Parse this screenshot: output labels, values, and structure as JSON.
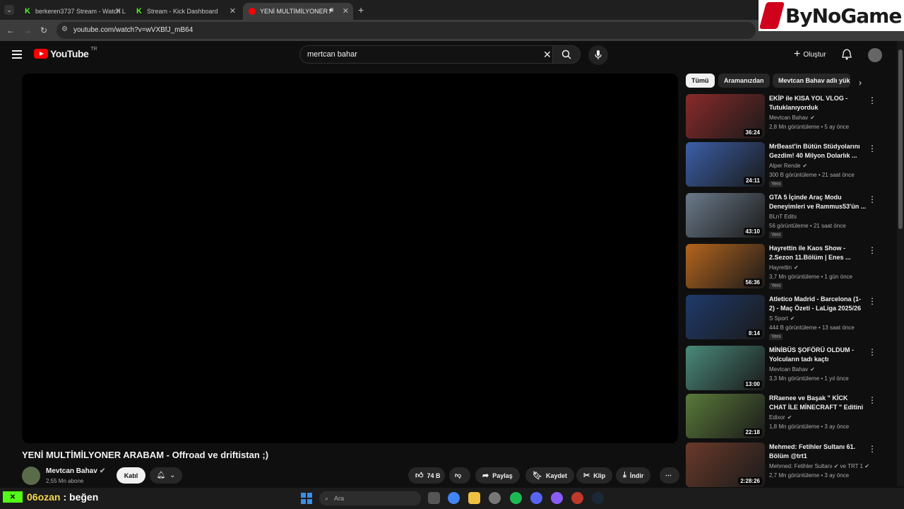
{
  "browser": {
    "tabs": [
      {
        "title": "berkeren3737 Stream - Watch L",
        "favicon": "kick-icon"
      },
      {
        "title": "Stream - Kick Dashboard",
        "favicon": "kick-icon"
      },
      {
        "title": "YENİ MULTİMİLYONER ARA",
        "favicon": "youtube-icon"
      }
    ],
    "url": "youtube.com/watch?v=wVXBfJ_mB64"
  },
  "watermark": {
    "text": "ByNoGame"
  },
  "youtube": {
    "logo_text": "YouTube",
    "region": "TR",
    "search_value": "mertcan bahar",
    "create_label": "Oluştur"
  },
  "video": {
    "title": "YENİ MULTİMİLYONER ARABAM - Offroad ve driftistan ;)",
    "channel": "Mevtcan Bahav",
    "subscribers": "2,55 Mn abone",
    "join_label": "Katıl",
    "likes": "74 B",
    "share_label": "Paylaş",
    "save_label": "Kaydet",
    "clip_label": "Klip",
    "download_label": "İndir"
  },
  "chips": [
    "Tümü",
    "Aramanızdan",
    "Mevtcan Bahav adlı yük"
  ],
  "recommendations": [
    {
      "title": "EKİP ile KISA YOL VLOG - Tutuklanıyorduk",
      "channel": "Mevtcan Bahav",
      "verified": true,
      "meta": "2,8 Mn görüntüleme • 5 ay önce",
      "duration": "36:24",
      "new": "",
      "color": "#8a2a2a"
    },
    {
      "title": "MrBeast'in Bütün Stüdyolarını Gezdim! 40 Milyon Dolarlık ...",
      "channel": "Alper Rende",
      "verified": true,
      "meta": "300 B görüntüleme • 21 saat önce",
      "duration": "24:11",
      "new": "Yeni",
      "color": "#3b5fa8"
    },
    {
      "title": "GTA 5 İçinde Araç Modu Deneyimleri ve Rammus53'ün ...",
      "channel": "BLnT Edits",
      "verified": false,
      "meta": "56 görüntüleme • 21 saat önce",
      "duration": "43:10",
      "new": "Yeni",
      "color": "#6b7a8a"
    },
    {
      "title": "Hayrettin ile Kaos Show - 2.Sezon 11.Bölüm | Enes ...",
      "channel": "Hayrettin",
      "verified": true,
      "meta": "3,7 Mn görüntüleme • 1 gün önce",
      "duration": "56:36",
      "new": "Yeni",
      "color": "#b5651d"
    },
    {
      "title": "Atletico Madrid - Barcelona (1-2) - Maç Özeti - LaLiga 2025/26",
      "channel": "S Sport",
      "verified": true,
      "meta": "444 B görüntüleme • 13 saat önce",
      "duration": "8:14",
      "new": "Yeni",
      "color": "#1f3a6b"
    },
    {
      "title": "MİNİBÜS ŞOFÖRÜ OLDUM - Yolcuların tadı kaçtı",
      "channel": "Mevtcan Bahav",
      "verified": true,
      "meta": "3,3 Mn görüntüleme • 1 yıl önce",
      "duration": "13:00",
      "new": "",
      "color": "#4a8a7a"
    },
    {
      "title": "RRaenee ve Başak \" KİCK CHAT İLE MİNECRAFT \" Editini İzliyor!",
      "channel": "Edixor",
      "verified": true,
      "meta": "1,8 Mn görüntüleme • 3 ay önce",
      "duration": "22:18",
      "new": "",
      "color": "#5a7a3a"
    },
    {
      "title": "Mehmed: Fetihler Sultanı 61. Bölüm @trt1",
      "channel": "Mehmed: Fetihler Sultanı ✔ ve TRT 1 ✔",
      "verified": false,
      "meta": "2,7 Mn görüntüleme • 3 ay önce",
      "duration": "2:28:26",
      "new": "",
      "color": "#6a3a2a"
    }
  ],
  "chat": {
    "user": "06ozan",
    "message": ": beğen"
  },
  "taskbar": {
    "search_placeholder": "Ara"
  }
}
